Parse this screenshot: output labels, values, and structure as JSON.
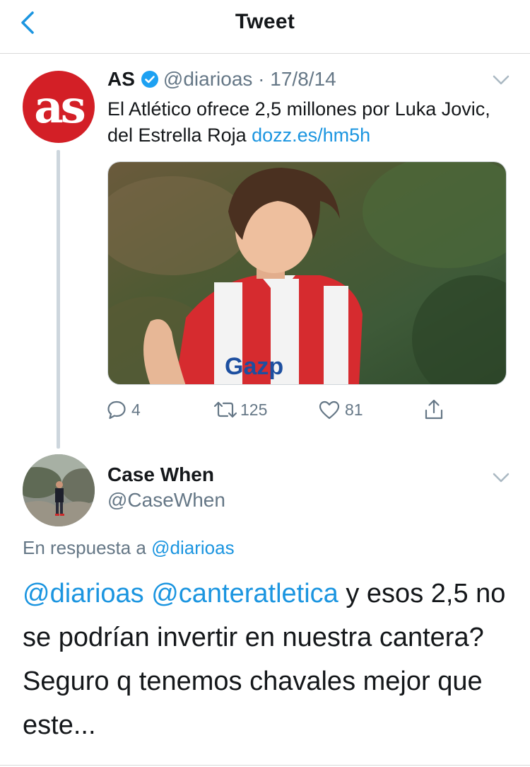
{
  "header": {
    "title": "Tweet"
  },
  "tweet1": {
    "author_name": "AS",
    "handle": "@diarioas",
    "separator": "·",
    "date": "17/8/14",
    "avatar_text": "as",
    "text": "El Atlético ofrece 2,5 millones por Luka Jovic, del Estrella Roja ",
    "link": "dozz.es/hm5h",
    "replies": "4",
    "retweets": "125",
    "likes": "81"
  },
  "tweet2": {
    "author_name": "Case When",
    "handle": "@CaseWhen",
    "reply_prefix": "En respuesta a ",
    "reply_to": "@diarioas",
    "mention1": "@diarioas",
    "mention2": "@canteratletica",
    "text": " y esos 2,5 no se podrían invertir en nuestra cantera? Seguro q tenemos chavales mejor que este..."
  },
  "colors": {
    "link": "#1b95e0",
    "muted": "#657786",
    "as_brand": "#d31f26",
    "verified": "#1da1f2"
  },
  "icons": [
    "back-chevron-icon",
    "verified-badge-icon",
    "chevron-down-icon",
    "reply-icon",
    "retweet-icon",
    "like-icon",
    "share-icon"
  ]
}
